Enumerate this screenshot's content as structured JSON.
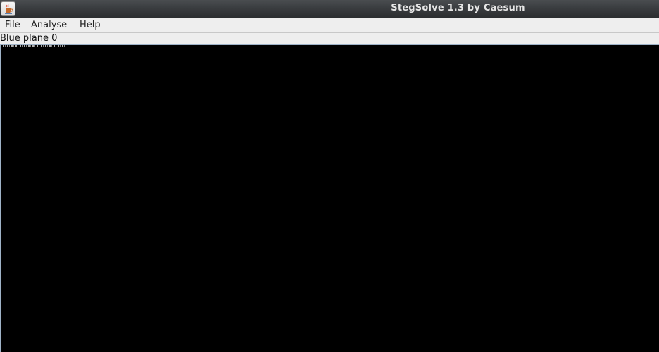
{
  "window": {
    "title": "StegSolve 1.3 by Caesum"
  },
  "menu": {
    "items": [
      {
        "label": "File"
      },
      {
        "label": "Analyse"
      },
      {
        "label": "Help"
      }
    ]
  },
  "status": {
    "plane_label": "Blue plane 0"
  },
  "colors": {
    "titlebar": "#3a3d40",
    "menubar": "#eeeeee",
    "canvas": "#000000"
  },
  "icons": {
    "app": "java-coffee-cup-icon"
  }
}
